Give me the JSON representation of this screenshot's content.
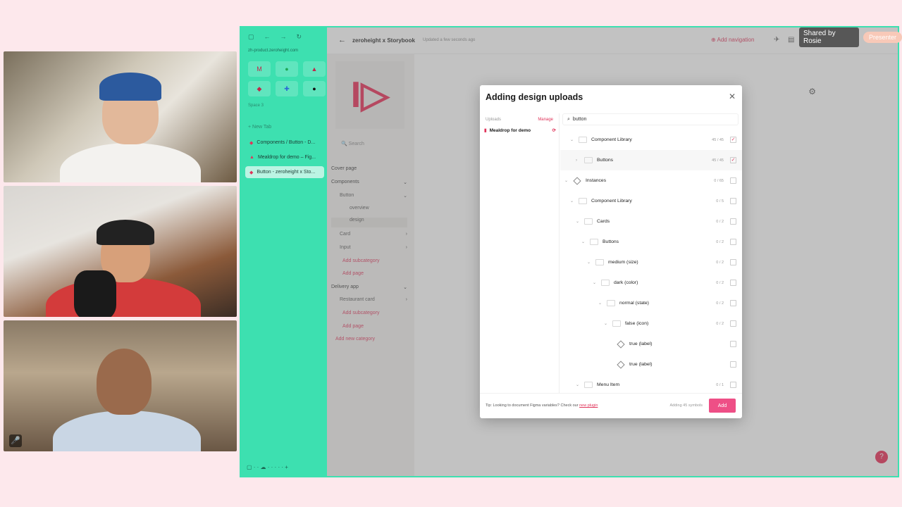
{
  "presenter": {
    "shared_by": "Shared by Rosie",
    "presenter_label": "Presenter"
  },
  "browser": {
    "url": "zh-product.zeroheight.com",
    "space": "Space 3",
    "new_tab": "New Tab",
    "tabs": [
      {
        "label": "Components / Button - D..."
      },
      {
        "label": "Mealdrop for demo – Fig..."
      },
      {
        "label": "Button - zeroheight x Sto..."
      }
    ]
  },
  "app": {
    "title": "zeroheight x Storybook",
    "updated": "Updated a few seconds ago",
    "add_navigation": "Add navigation",
    "search_placeholder": "Search",
    "nav": [
      {
        "label": "Cover page"
      },
      {
        "label": "Components"
      },
      {
        "label": "Button"
      },
      {
        "label": "overview"
      },
      {
        "label": "design"
      },
      {
        "label": "Card"
      },
      {
        "label": "Input"
      },
      {
        "label": "Add subcategory"
      },
      {
        "label": "Add page"
      },
      {
        "label": "Delivery app"
      },
      {
        "label": "Restaurant card"
      },
      {
        "label": "Add subcategory"
      },
      {
        "label": "Add page"
      },
      {
        "label": "Add new category"
      }
    ],
    "help": "?"
  },
  "modal": {
    "title": "Adding design uploads",
    "uploads_label": "Uploads",
    "manage": "Manage",
    "upload_name": "Mealdrop for demo",
    "search_value": "button",
    "rows": [
      {
        "label": "Component Library",
        "count": "45 / 45",
        "checked": true
      },
      {
        "label": "Buttons",
        "count": "45 / 45",
        "checked": true
      },
      {
        "label": "Instances",
        "count": "0 / 65",
        "checked": false
      },
      {
        "label": "Component Library",
        "count": "0 / 5",
        "checked": false
      },
      {
        "label": "Cards",
        "count": "0 / 2",
        "checked": false
      },
      {
        "label": "Buttons",
        "count": "0 / 2",
        "checked": false
      },
      {
        "label": "medium (size)",
        "count": "0 / 2",
        "checked": false
      },
      {
        "label": "dark (color)",
        "count": "0 / 2",
        "checked": false
      },
      {
        "label": "normal (state)",
        "count": "0 / 2",
        "checked": false
      },
      {
        "label": "false (icon)",
        "count": "0 / 2",
        "checked": false
      },
      {
        "label": "true (label)",
        "count": "",
        "checked": false
      },
      {
        "label": "true (label)",
        "count": "",
        "checked": false
      },
      {
        "label": "Menu Item",
        "count": "0 / 1",
        "checked": false
      }
    ],
    "tip_text": "Tip: Looking to document Figma variables? Check our",
    "tip_link": "new plugin",
    "adding_text": "Adding 45 symbols",
    "add_button": "Add",
    "check_mark": "✓"
  }
}
